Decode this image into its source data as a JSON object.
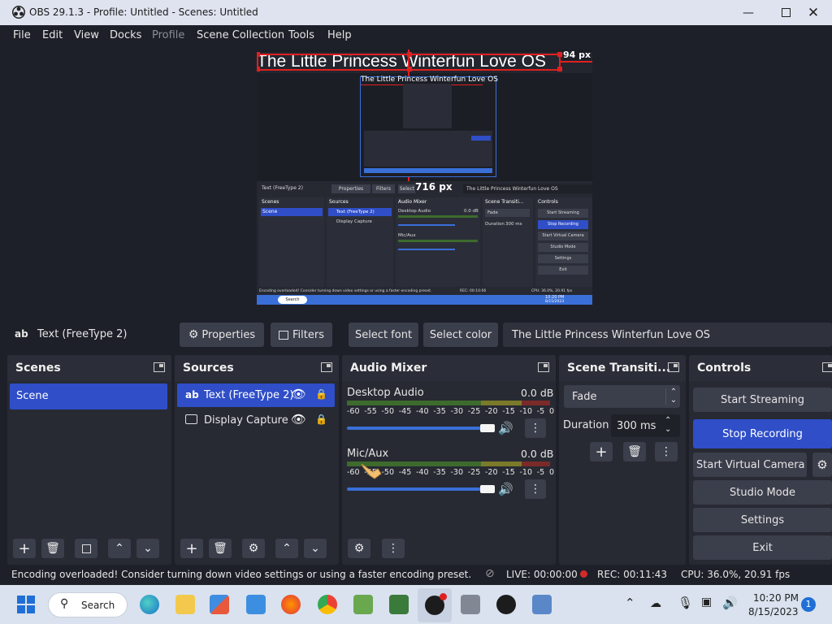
{
  "window": {
    "title": "OBS 29.1.3 - Profile: Untitled - Scenes: Untitled"
  },
  "menu": [
    "File",
    "Edit",
    "View",
    "Docks",
    "Profile",
    "Scene Collection",
    "Tools",
    "Help"
  ],
  "preview": {
    "source_text": "The Little Princess Winterfun Love OS",
    "px_top": "94 px",
    "px_mid": "716 px",
    "nested": {
      "source_name": "Text (FreeType 2)",
      "properties": "Properties",
      "filters": "Filters",
      "select": "Select",
      "text": "The Little Princess Winterfun Love OS",
      "scenes": "Scenes",
      "sources": "Sources",
      "audio_mixer": "Audio Mixer",
      "scene_transitions": "Scene Transiti...",
      "controls": "Controls",
      "scene": "Scene",
      "src1": "Text (FreeType 2)",
      "src2": "Display Capture",
      "desktop_audio": "Desktop Audio",
      "mic_aux": "Mic/Aux",
      "db": "0.0 dB",
      "fade": "Fade",
      "duration": "Duration",
      "duration_val": "300 ms",
      "start_streaming": "Start Streaming",
      "stop_recording": "Stop Recording",
      "start_virtual_camera": "Start Virtual Camera",
      "studio_mode": "Studio Mode",
      "settings": "Settings",
      "exit": "Exit",
      "status": "Encoding overloaded! Consider turning down video settings or using a faster encoding preset.",
      "live": "LIVE: 00:00:00",
      "rec": "REC: 00:10:06",
      "cpu": "CPU: 36.0%, 20.91 fps",
      "search": "Search",
      "time": "10:20 PM",
      "date": "8/15/2023"
    }
  },
  "context_bar": {
    "source_name": "Text (FreeType 2)",
    "properties": "Properties",
    "filters": "Filters",
    "select_font": "Select font",
    "select_color": "Select color",
    "text_value": "The Little Princess Winterfun Love OS"
  },
  "docks": {
    "scenes": {
      "title": "Scenes",
      "items": [
        "Scene"
      ]
    },
    "sources": {
      "title": "Sources",
      "items": [
        "Text (FreeType 2)",
        "Display Capture"
      ]
    },
    "audio_mixer": {
      "title": "Audio Mixer",
      "channels": [
        {
          "name": "Desktop Audio",
          "db": "0.0 dB"
        },
        {
          "name": "Mic/Aux",
          "db": "0.0 dB"
        }
      ],
      "scale": [
        "-60",
        "-55",
        "-50",
        "-45",
        "-40",
        "-35",
        "-30",
        "-25",
        "-20",
        "-15",
        "-10",
        "-5",
        "0"
      ]
    },
    "transitions": {
      "title": "Scene Transiti...",
      "selected": "Fade",
      "duration_label": "Duration",
      "duration_value": "300 ms"
    },
    "controls": {
      "title": "Controls",
      "buttons": [
        "Start Streaming",
        "Stop Recording",
        "Start Virtual Camera",
        "Studio Mode",
        "Settings",
        "Exit"
      ]
    }
  },
  "status": {
    "message": "Encoding overloaded! Consider turning down video settings or using a faster encoding preset.",
    "live": "LIVE: 00:00:00",
    "rec": "REC: 00:11:43",
    "cpu": "CPU: 36.0%, 20.91 fps"
  },
  "taskbar": {
    "search": "Search",
    "time": "10:20 PM",
    "date": "8/15/2023",
    "badge": "1"
  },
  "colors": {
    "accent": "#2f4ec8",
    "panel": "#272a33",
    "bg": "#1e2029",
    "button": "#3b3e4b",
    "record": "#d42a2a"
  }
}
